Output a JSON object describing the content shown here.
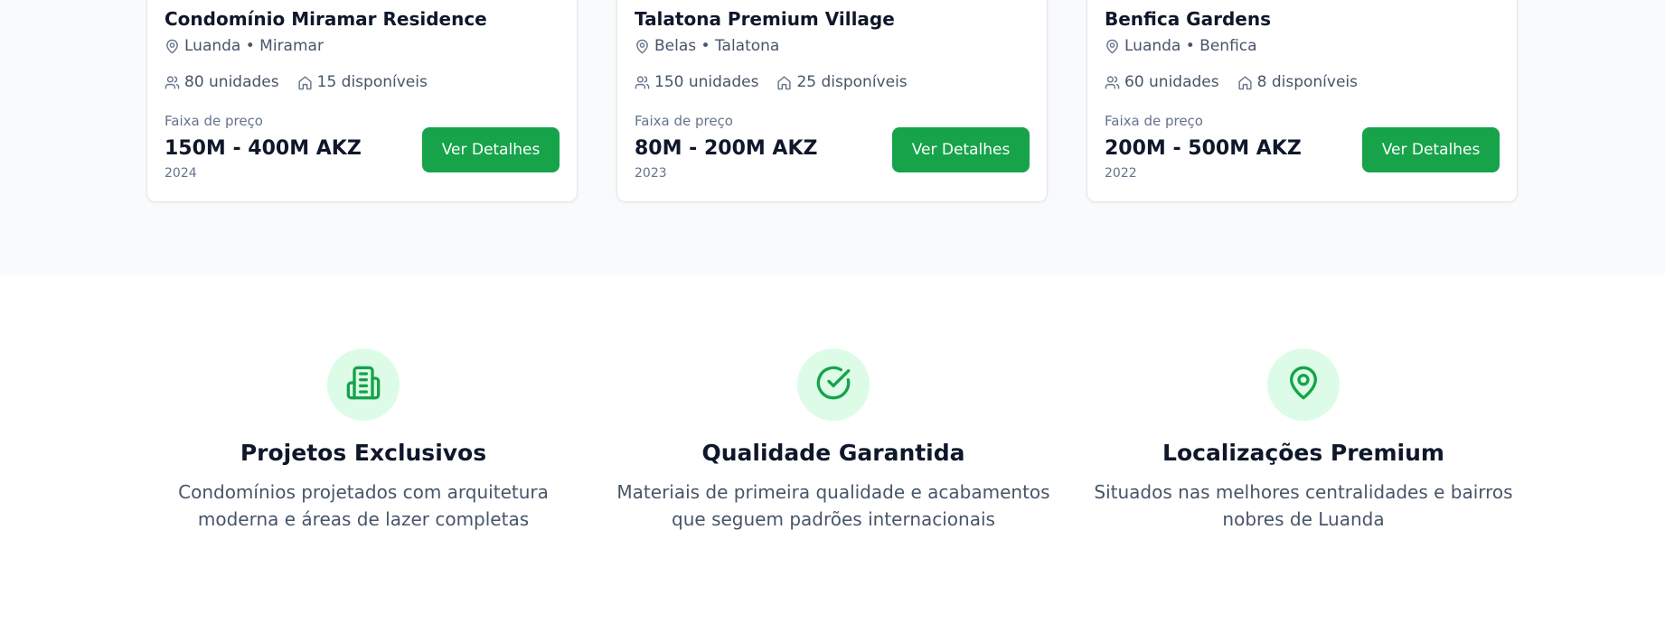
{
  "projects": [
    {
      "title": "Condomínio Miramar Residence",
      "location": "Luanda • Miramar",
      "units": "80 unidades",
      "available": "15 disponíveis",
      "price_label": "Faixa de preço",
      "price": "150M - 400M AKZ",
      "year": "2024",
      "button": "Ver Detalhes"
    },
    {
      "title": "Talatona Premium Village",
      "location": "Belas • Talatona",
      "units": "150 unidades",
      "available": "25 disponíveis",
      "price_label": "Faixa de preço",
      "price": "80M - 200M AKZ",
      "year": "2023",
      "button": "Ver Detalhes"
    },
    {
      "title": "Benfica Gardens",
      "location": "Luanda • Benfica",
      "units": "60 unidades",
      "available": "8 disponíveis",
      "price_label": "Faixa de preço",
      "price": "200M - 500M AKZ",
      "year": "2022",
      "button": "Ver Detalhes"
    }
  ],
  "features": [
    {
      "icon": "building-icon",
      "title": "Projetos Exclusivos",
      "description": "Condomínios projetados com arquitetura moderna e áreas de lazer completas"
    },
    {
      "icon": "check-circle-icon",
      "title": "Qualidade Garantida",
      "description": "Materiais de primeira qualidade e acabamentos que seguem padrões internacionais"
    },
    {
      "icon": "map-pin-icon",
      "title": "Localizações Premium",
      "description": "Situados nas melhores centralidades e bairros nobres de Luanda"
    }
  ],
  "colors": {
    "accent": "#16a34a",
    "accent_light": "#dcfce7",
    "section_bg": "#f8fafc"
  }
}
